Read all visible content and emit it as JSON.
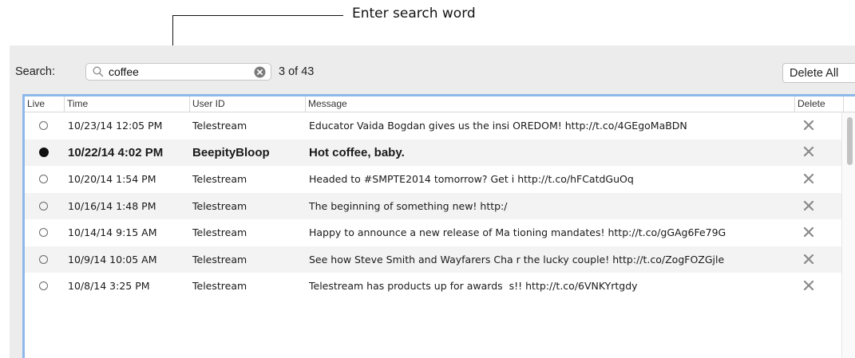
{
  "callout": {
    "text": "Enter search word"
  },
  "search": {
    "label": "Search:",
    "value": "coffee",
    "result_count": "3 of 43",
    "delete_all_label": "Delete All"
  },
  "table": {
    "headers": {
      "live": "Live",
      "time": "Time",
      "user": "User ID",
      "message": "Message",
      "delete": "Delete"
    },
    "rows": [
      {
        "live": false,
        "time": "10/23/14 12:05 PM",
        "user": "Telestream",
        "message": "Educator Vaida Bogdan gives us the insi OREDOM! http://t.co/4GEgoMaBDN",
        "bold": false
      },
      {
        "live": true,
        "time": "10/22/14 4:02 PM",
        "user": "BeepityBloop",
        "message": "Hot coffee, baby.",
        "bold": true
      },
      {
        "live": false,
        "time": "10/20/14 1:54 PM",
        "user": "Telestream",
        "message": "Headed to #SMPTE2014 tomorrow? Get i http://t.co/hFCatdGuOq",
        "bold": false
      },
      {
        "live": false,
        "time": "10/16/14 1:48 PM",
        "user": "Telestream",
        "message": "The beginning of something new! http:/",
        "bold": false
      },
      {
        "live": false,
        "time": "10/14/14 9:15 AM",
        "user": "Telestream",
        "message": "Happy to announce a new release of Ma tioning mandates! http://t.co/gGAg6Fe79G",
        "bold": false
      },
      {
        "live": false,
        "time": "10/9/14 10:05 AM",
        "user": "Telestream",
        "message": "See how Steve Smith and Wayfarers Cha r the lucky couple! http://t.co/ZogFOZGjle",
        "bold": false
      },
      {
        "live": false,
        "time": "10/8/14 3:25 PM",
        "user": "Telestream",
        "message": "Telestream has products up for awards  s!! http://t.co/6VNKYrtgdy",
        "bold": false
      }
    ]
  },
  "icons": {
    "search": "magnifier-icon",
    "clear": "clear-circle-icon",
    "delete": "close-x-icon"
  },
  "colors": {
    "selection_border": "#8db8ea",
    "panel_bg": "#ececec",
    "alt_row": "#f3f3f3"
  }
}
